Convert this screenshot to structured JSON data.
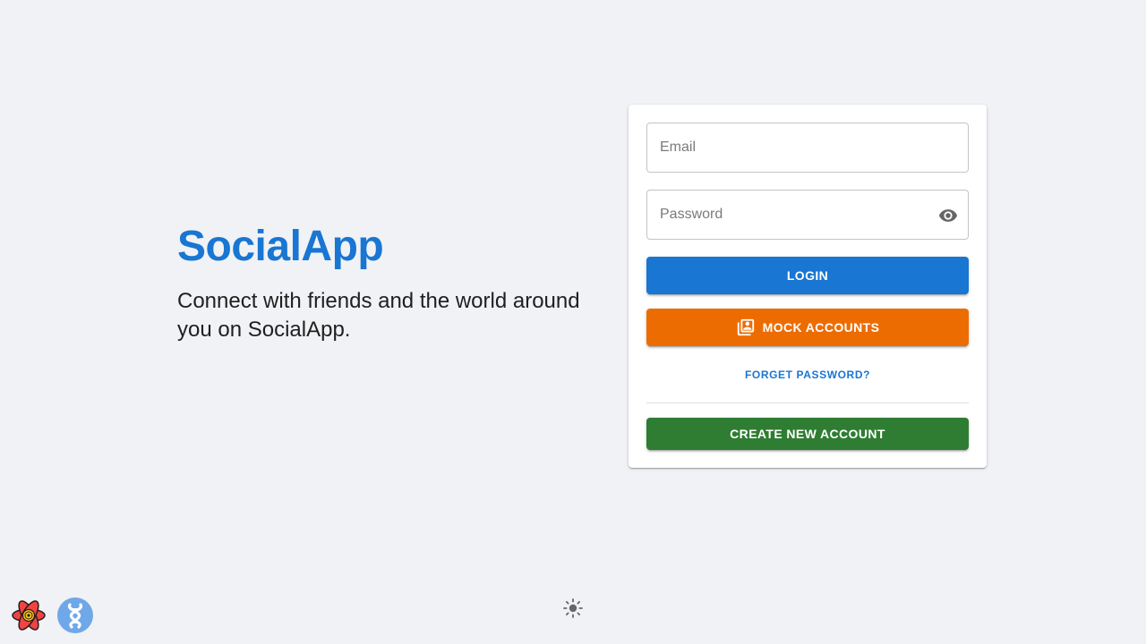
{
  "app": {
    "name": "SocialApp",
    "tagline": "Connect with friends and the world around you on SocialApp."
  },
  "login_form": {
    "email_placeholder": "Email",
    "email_value": "",
    "password_placeholder": "Password",
    "password_value": "",
    "toggle_visibility_icon": "eye-icon",
    "login_label": "LOGIN",
    "mock_accounts_label": "MOCK ACCOUNTS",
    "mock_accounts_icon": "contacts-stack-icon",
    "forgot_password_label": "FORGET PASSWORD?",
    "create_account_label": "CREATE NEW ACCOUNT"
  },
  "footer": {
    "devtools_icons": [
      "react-query-devtools-icon",
      "redux-devtools-icon"
    ],
    "theme_toggle_icon": "sun-icon"
  },
  "colors": {
    "primary": "#1976d2",
    "warning": "#ed6c02",
    "success": "#2e7d32",
    "background": "#f0f2f5"
  }
}
